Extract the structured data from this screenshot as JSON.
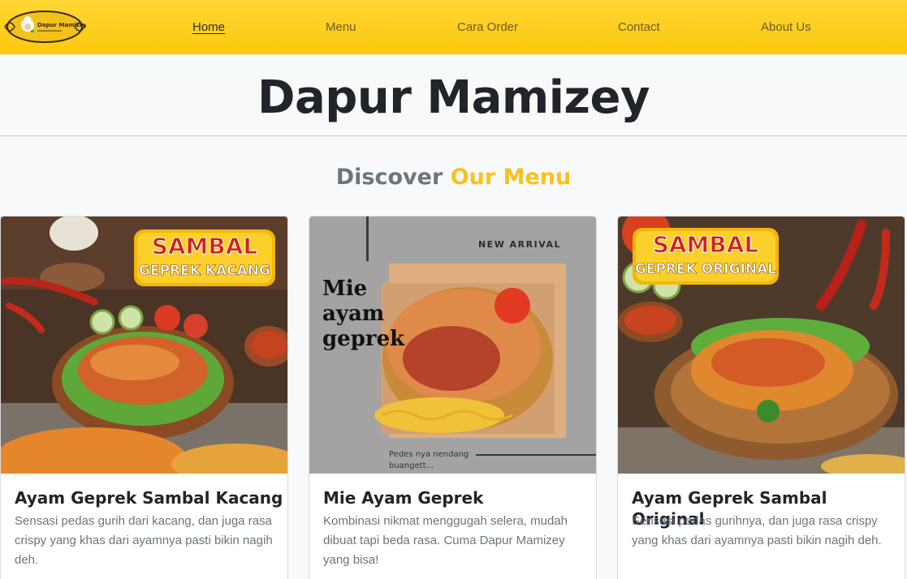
{
  "navbar": {
    "logo_text": "Dapur Mamizey",
    "links": [
      {
        "label": "Home",
        "active": true
      },
      {
        "label": "Menu",
        "active": false
      },
      {
        "label": "Cara Order",
        "active": false
      },
      {
        "label": "Contact",
        "active": false
      },
      {
        "label": "About Us",
        "active": false
      }
    ],
    "accent_color": "#fdc80f"
  },
  "hero": {
    "title": "Dapur Mamizey"
  },
  "section": {
    "heading_part1": "Discover",
    "heading_part2": "Our Menu",
    "heading_accent": "#f7c21b"
  },
  "menu": [
    {
      "image_banner_line1": "SAMBAL",
      "image_banner_line2": "GEPREK KACANG",
      "title": "Ayam Geprek Sambal Kacang",
      "description": "Sensasi pedas gurih dari kacang, dan juga rasa crispy yang khas dari ayamnya pasti bikin nagih deh."
    },
    {
      "image_tag": "NEW ARRIVAL",
      "image_heading": "Mie ayam geprek",
      "image_caption": "Pedes nya nendang buangett...",
      "title": "Mie Ayam Geprek",
      "description": "Kombinasi nikmat menggugah selera, mudah dibuat tapi beda rasa. Cuma Dapur Mamizey yang bisa!"
    },
    {
      "image_banner_line1": "SAMBAL",
      "image_banner_line2": "GEPREK ORIGINAL",
      "title": "Ayam Geprek Sambal Original",
      "description": "Sensasi pedas gurihnya, dan juga rasa crispy yang khas dari ayamnya pasti bikin nagih deh."
    }
  ]
}
